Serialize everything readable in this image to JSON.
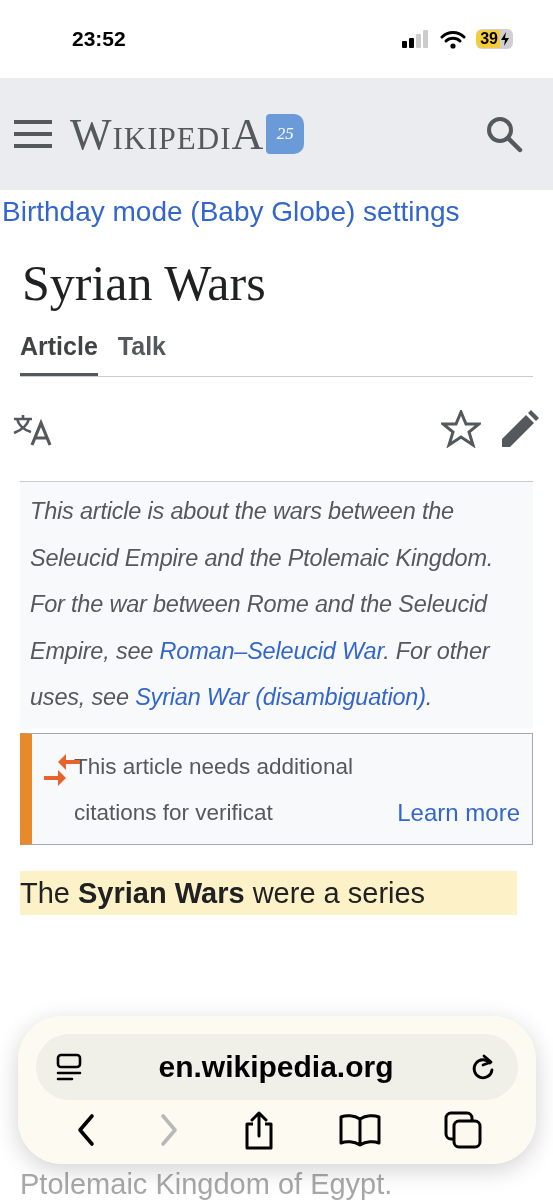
{
  "status_bar": {
    "time": "23:52",
    "battery": "39"
  },
  "header": {
    "logo": "WikipediA",
    "logo_badge": "25"
  },
  "banner_link": "Birthday mode (Baby Globe) settings",
  "title": "Syrian Wars",
  "tabs": [
    {
      "label": "Article",
      "selected": true
    },
    {
      "label": "Talk",
      "selected": false
    }
  ],
  "hatnote": [
    {
      "kind": "text",
      "text": "This article is about the wars between the Seleucid Empire and the Ptolemaic Kingdom. For the war between Rome and the Seleucid Empire, see "
    },
    {
      "kind": "link",
      "text": "Roman–Seleucid War"
    },
    {
      "kind": "text",
      "text": ". For other uses, see "
    },
    {
      "kind": "link",
      "text": "Syrian War (disambiguation)"
    },
    {
      "kind": "text",
      "text": "."
    }
  ],
  "notice": {
    "text": "This article needs additional citations for verificat",
    "link": "Learn more"
  },
  "paragraph_lines": [
    {
      "text": "The **Syrian Wars** were a series",
      "highlighted": true
    },
    {
      "text": "Ptolemaic Kingdom of Egypt.",
      "highlighted": false
    }
  ],
  "browser_bar": {
    "url": "en.wikipedia.org",
    "forward_disabled": true
  }
}
